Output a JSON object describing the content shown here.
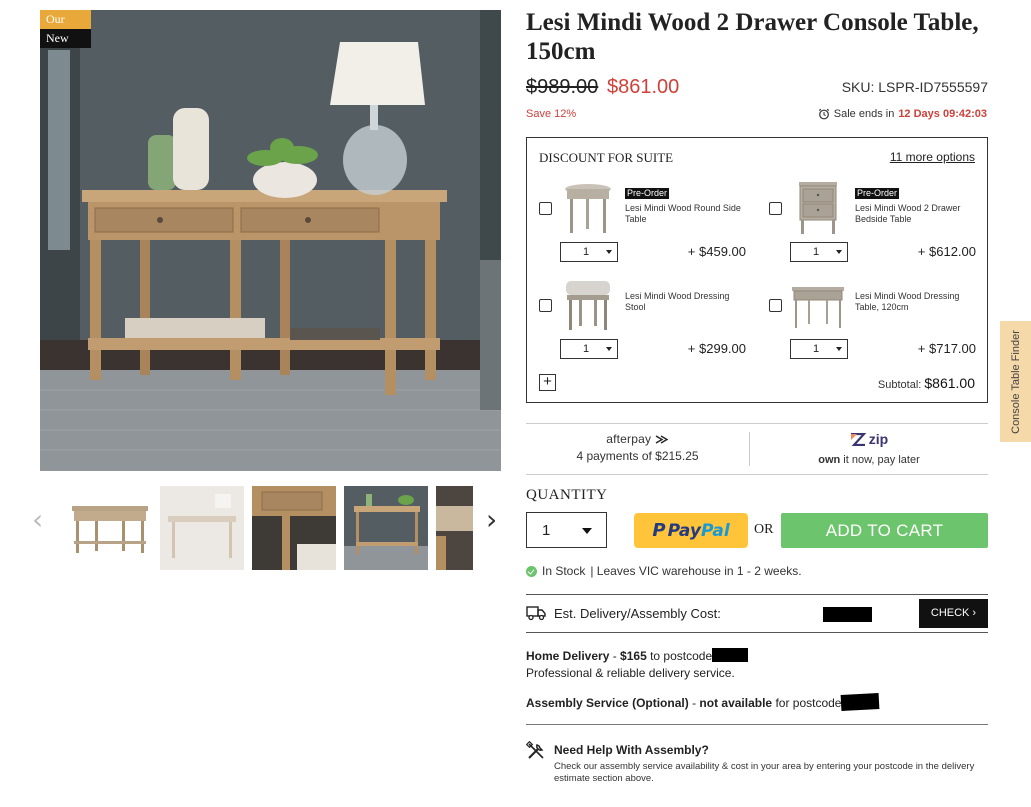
{
  "gallery": {
    "badges": {
      "pick": "Our Pick",
      "new": "New"
    },
    "main_image_alt": "",
    "thumb_count": 5
  },
  "product": {
    "title": "Lesi Mindi Wood 2 Drawer Console Table, 150cm",
    "price_old": "$989.00",
    "price_new": "$861.00",
    "sku": "SKU: LSPR-ID7555597",
    "save": "Save 12%",
    "sale_ends_label": "Sale ends in",
    "sale_ends_timer": "12 Days 09:42:03"
  },
  "suite": {
    "title": "DISCOUNT FOR SUITE",
    "more_options": "11 more options",
    "items": [
      {
        "preorder": "Pre-Order",
        "name": "Lesi Mindi Wood Round Side Table",
        "qty": "1",
        "price": "+ $459.00",
        "checked": false
      },
      {
        "preorder": "Pre-Order",
        "name": "Lesi Mindi Wood 2 Drawer Bedside Table",
        "qty": "1",
        "price": "+ $612.00",
        "checked": false
      },
      {
        "preorder": "",
        "name": "Lesi Mindi Wood Dressing Stool",
        "qty": "1",
        "price": "+ $299.00",
        "checked": false
      },
      {
        "preorder": "",
        "name": "Lesi Mindi Wood Dressing Table, 120cm",
        "qty": "1",
        "price": "+ $717.00",
        "checked": false
      }
    ],
    "add_label": "+",
    "subtotal_label": "Subtotal:",
    "subtotal_value": "$861.00"
  },
  "payments": {
    "afterpay_logo_a": "afterpay",
    "afterpay_text": "4 payments of $215.25",
    "zip_logo": "zip",
    "zip_text_bold": "own",
    "zip_text": " it now, pay later"
  },
  "purchase": {
    "quantity_label": "QUANTITY",
    "quantity_value": "1",
    "paypal_a": "Pay",
    "paypal_b": "Pal",
    "or_label": "OR",
    "add_to_cart": "ADD TO CART",
    "stock_status": "In Stock",
    "stock_detail": "|  Leaves VIC warehouse in 1 - 2 weeks."
  },
  "delivery": {
    "est_label": "Est. Delivery/Assembly Cost:",
    "check_button": "CHECK ›",
    "home_delivery_label": "Home Delivery",
    "home_delivery_sep": " - ",
    "home_delivery_price": "$165",
    "home_delivery_to": " to postcode",
    "home_delivery_note": "Professional & reliable delivery service.",
    "assembly_label": "Assembly Service (Optional)",
    "assembly_sep": " - ",
    "assembly_status": "not available",
    "assembly_for": " for postcode"
  },
  "help": {
    "title": "Need Help With Assembly?",
    "text": "Check our assembly service availability & cost in your area by entering your postcode in the delivery estimate section above."
  },
  "side_tab": {
    "label": "Console Table Finder"
  },
  "colors": {
    "sale_red": "#d0403a",
    "cart_green": "#6cc46c",
    "paypal_yellow": "#ffc439",
    "badge_orange": "#e9a93a",
    "side_tab": "#f6d9a8"
  }
}
